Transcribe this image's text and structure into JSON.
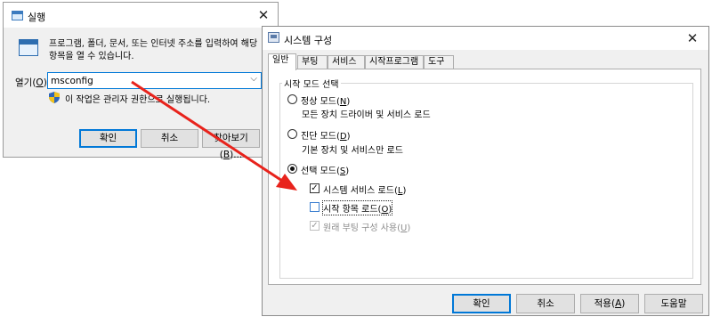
{
  "run_dialog": {
    "title": "실행",
    "description": "프로그램, 폴더, 문서, 또는 인터넷 주소를 입력하여 해당 항목을 열 수 있습니다.",
    "open_label": "열기(",
    "open_key": "O",
    "open_label_end": "):",
    "open_value": "msconfig",
    "admin_note": "이 작업은 관리자 권한으로 실행됩니다.",
    "ok_label": "확인",
    "cancel_label": "취소",
    "browse_label": "찾아보기(",
    "browse_key": "B",
    "browse_label_end": ")..."
  },
  "sysconfig": {
    "title": "시스템 구성",
    "tabs": [
      "일반",
      "부팅",
      "서비스",
      "시작프로그램",
      "도구"
    ],
    "active_tab": "일반",
    "group_title": "시작 모드 선택",
    "normal": {
      "label": "정상 모드(",
      "key": "N",
      "label_end": ")",
      "desc": "모든 장치 드라이버 및 서비스 로드",
      "selected": false
    },
    "diagnostic": {
      "label": "진단 모드(",
      "key": "D",
      "label_end": ")",
      "desc": "기본 장치 및 서비스만 로드",
      "selected": false
    },
    "selective": {
      "label": "선택 모드(",
      "key": "S",
      "label_end": ")",
      "selected": true
    },
    "load_system_services": {
      "label": "시스템 서비스 로드(",
      "key": "L",
      "label_end": ")",
      "checked": true
    },
    "load_startup_items": {
      "label": "시작 항목 로드(",
      "key": "O",
      "label_end": ")",
      "checked": false
    },
    "use_original_boot": {
      "label": "원래 부팅 구성 사용(",
      "key": "U",
      "label_end": ")",
      "checked": true,
      "disabled": true
    },
    "ok_label": "확인",
    "cancel_label": "취소",
    "apply_label": "적용(",
    "apply_key": "A",
    "apply_label_end": ")",
    "help_label": "도움말"
  },
  "annotation": {
    "arrow_color": "#e8231c"
  },
  "icons": {
    "run": "run-app-icon",
    "run_large": "run-program-icon",
    "shield": "uac-shield-icon",
    "sysconfig": "system-configuration-icon",
    "close": "close-icon"
  }
}
